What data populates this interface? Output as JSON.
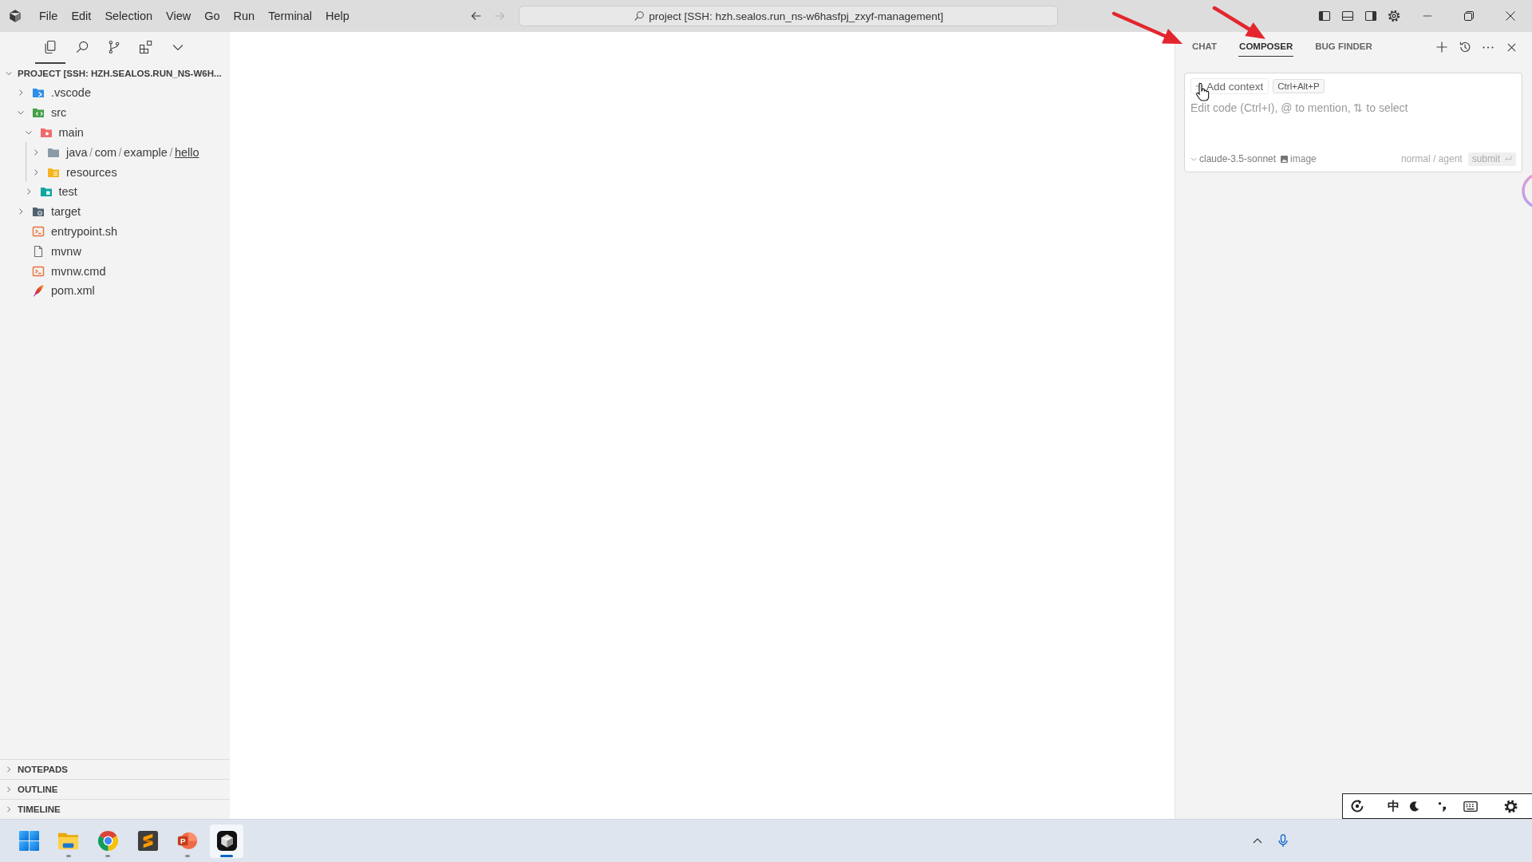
{
  "title_bar": {
    "menu": [
      "File",
      "Edit",
      "Selection",
      "View",
      "Go",
      "Run",
      "Terminal",
      "Help"
    ],
    "navigation": [
      {
        "kind": "back",
        "disabled": false
      },
      {
        "kind": "forward",
        "disabled": true
      }
    ],
    "command_center": "project [SSH: hzh.sealos.run_ns-w6hasfpj_zxyf-management]",
    "layout_toggles": [
      {
        "kind": "sidebar",
        "on": true
      },
      {
        "kind": "panel",
        "on": false
      },
      {
        "kind": "secondary",
        "on": true
      }
    ]
  },
  "sidebar": {
    "views": [
      {
        "kind": "explorer",
        "selected": true
      },
      {
        "kind": "search",
        "selected": false
      },
      {
        "kind": "source-control",
        "selected": false
      },
      {
        "kind": "extensions",
        "selected": false
      }
    ],
    "explorer": {
      "title": "PROJECT [SSH: HZH.SEALOS.RUN_NS-W6H...",
      "expanded": true,
      "tree": [
        {
          "name": ".vscode",
          "kind": "vscode",
          "expanded": false
        },
        {
          "name": "src",
          "kind": "source",
          "expanded": true,
          "children": [
            {
              "name": "main",
              "kind": "main",
              "expanded": true,
              "children": [
                {
                  "segments": [
                    {
                      "text": "java",
                      "selected": false
                    },
                    {
                      "text": "com",
                      "selected": false
                    },
                    {
                      "text": "example",
                      "selected": false
                    },
                    {
                      "text": "hello",
                      "selected": true
                    }
                  ],
                  "separator": "/",
                  "kind": "package",
                  "expanded": false
                },
                {
                  "name": "resources",
                  "kind": "resources",
                  "expanded": false
                }
              ]
            },
            {
              "name": "test",
              "kind": "test",
              "expanded": false
            }
          ]
        },
        {
          "name": "target",
          "kind": "target",
          "expanded": false
        },
        {
          "name": "entrypoint.sh",
          "kind": "script"
        },
        {
          "name": "mvnw",
          "kind": "text"
        },
        {
          "name": "mvnw.cmd",
          "kind": "script"
        },
        {
          "name": "pom.xml",
          "kind": "maven"
        }
      ]
    },
    "sections": [
      {
        "title": "NOTEPADS",
        "expanded": false
      },
      {
        "title": "OUTLINE",
        "expanded": false
      },
      {
        "title": "TIMELINE",
        "expanded": false
      }
    ]
  },
  "panel": {
    "tabs": [
      {
        "label": "CHAT",
        "selected": false
      },
      {
        "label": "COMPOSER",
        "selected": true
      },
      {
        "label": "BUG FINDER",
        "selected": false
      }
    ],
    "composer": {
      "context_button": "Add context",
      "shortcut": "Ctrl+Alt+P",
      "placeholder": "Edit code (Ctrl+I), @ to mention, ⇅ to select",
      "model": "claude-3.5-sonnet",
      "attach": "image",
      "mode": "normal / agent",
      "submit": {
        "label": "submit",
        "disabled": true
      }
    }
  },
  "taskbar": {
    "apps": [
      {
        "kind": "start",
        "running": false,
        "selected": false
      },
      {
        "kind": "explorer",
        "running": true,
        "selected": false
      },
      {
        "kind": "chrome",
        "running": true,
        "selected": false
      },
      {
        "kind": "sublime",
        "running": false,
        "selected": false
      },
      {
        "kind": "powerpoint",
        "label": "P",
        "running": true,
        "selected": false
      },
      {
        "kind": "cursor",
        "running": true,
        "selected": true
      }
    ]
  },
  "ime_toolbar": {
    "mode": "中"
  }
}
